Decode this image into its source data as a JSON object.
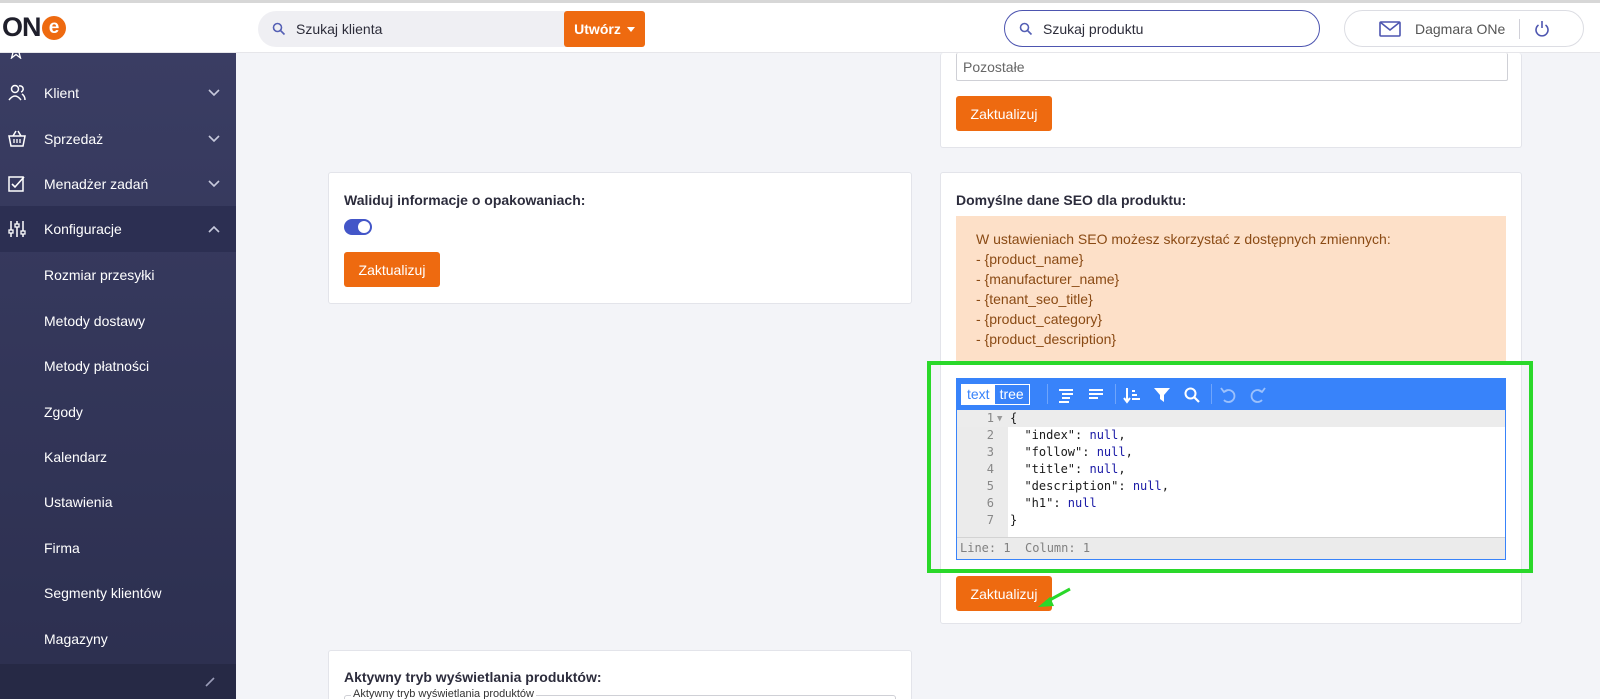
{
  "header": {
    "logo_text": "ON",
    "logo_e": "e",
    "client_search_placeholder": "Szukaj klienta",
    "create_label": "Utwórz",
    "product_search_placeholder": "Szukaj produktu",
    "user_name": "Dagmara ONe"
  },
  "sidebar": {
    "items": [
      {
        "label": "Klient",
        "icon": "users-icon"
      },
      {
        "label": "Sprzedaż",
        "icon": "basket-icon"
      },
      {
        "label": "Menadżer zadań",
        "icon": "tasks-icon"
      },
      {
        "label": "Konfiguracje",
        "icon": "sliders-icon"
      }
    ],
    "subitems": [
      "Rozmiar przesyłki",
      "Metody dostawy",
      "Metody płatności",
      "Zgody",
      "Kalendarz",
      "Ustawienia",
      "Firma",
      "Segmenty klientów",
      "Magazyny"
    ]
  },
  "cards": {
    "other_input_value": "Pozostałe",
    "update_label": "Zaktualizuj",
    "validate_title": "Waliduj informacje o opakowaniach:",
    "validate_toggle_on": true,
    "seo_title": "Domyślne dane SEO dla produktu:",
    "seo_note_lines": [
      "W ustawieniach SEO możesz skorzystać z dostępnych zmiennych:",
      "- {product_name}",
      "- {manufacturer_name}",
      "- {tenant_seo_title}",
      "- {product_category}",
      "- {product_description}"
    ],
    "display_mode_title": "Aktywny tryb wyświetlania produktów:",
    "display_mode_field_label": "Aktywny tryb wyświetlania produktów"
  },
  "editor": {
    "mode_text": "text",
    "mode_tree": "tree",
    "line_numbers": [
      "1",
      "2",
      "3",
      "4",
      "5",
      "6",
      "7"
    ],
    "lines": [
      {
        "pre": "{",
        "null": "",
        "post": ""
      },
      {
        "pre": "  \"index\": ",
        "null": "null",
        "post": ","
      },
      {
        "pre": "  \"follow\": ",
        "null": "null",
        "post": ","
      },
      {
        "pre": "  \"title\": ",
        "null": "null",
        "post": ","
      },
      {
        "pre": "  \"description\": ",
        "null": "null",
        "post": ","
      },
      {
        "pre": "  \"h1\": ",
        "null": "null",
        "post": ""
      },
      {
        "pre": "}",
        "null": "",
        "post": ""
      }
    ],
    "status": "Line: 1  Column: 1"
  },
  "colors": {
    "accent": "#ee6a10",
    "sidebar": "#3a3d63",
    "editor_blue": "#3883fa",
    "highlight": "#2ad82a"
  }
}
